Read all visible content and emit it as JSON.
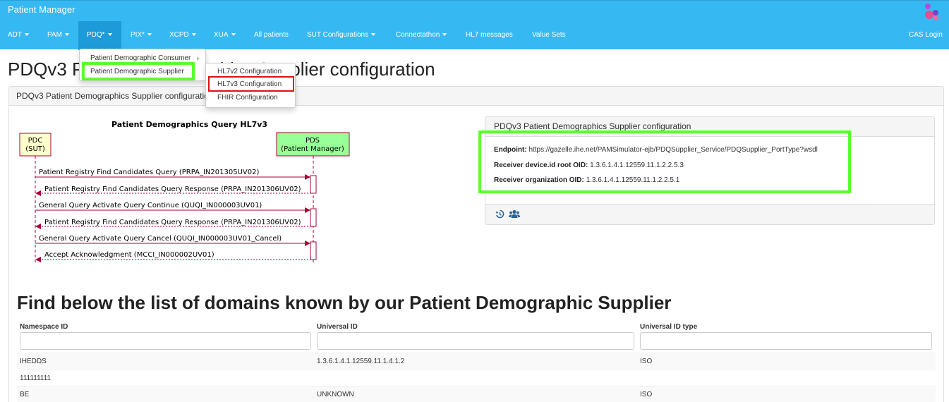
{
  "app": {
    "title": "Patient Manager"
  },
  "nav": {
    "items": [
      {
        "label": "ADT"
      },
      {
        "label": "PAM"
      },
      {
        "label": "PDQ*"
      },
      {
        "label": "PIX*"
      },
      {
        "label": "XCPD"
      },
      {
        "label": "XUA"
      },
      {
        "label": "All patients"
      },
      {
        "label": "SUT Configurations"
      },
      {
        "label": "Connectathon"
      },
      {
        "label": "HL7 messages"
      },
      {
        "label": "Value Sets"
      }
    ],
    "login": "CAS Login"
  },
  "page": {
    "title": "PDQv3 Patient Demographics Supplier configuration"
  },
  "panel": {
    "heading": "PDQv3 Patient Demographics Supplier configuration"
  },
  "dropdown": {
    "items": [
      {
        "label": "Patient Demographic Consumer"
      },
      {
        "label": "Patient Demographic Supplier"
      }
    ],
    "submenu": [
      {
        "label": "HL7v2 Configuration"
      },
      {
        "label": "HL7v3 Configuration"
      },
      {
        "label": "FHIR Configuration"
      }
    ]
  },
  "sequence": {
    "title": "Patient Demographics Query HL7v3",
    "actor_left": {
      "line1": "PDC",
      "line2": "(SUT)"
    },
    "actor_right": {
      "line1": "PDS",
      "line2": "(Patient Manager)"
    },
    "messages": [
      "Patient Registry Find Candidates Query (PRPA_IN201305UV02)",
      "Patient Registry Find Candidates Query Response (PRPA_IN201306UV02)",
      "General Query Activate Query Continue (QUQI_IN000003UV01)",
      "Patient Registry Find Candidates Query Response (PRPA_IN201306UV02)",
      "General Query Activate Query Cancel (QUQI_IN000003UV01_Cancel)",
      "Accept Acknowledgment (MCCI_IN000002UV01)"
    ]
  },
  "config": {
    "heading": "PDQv3 Patient Demographics Supplier configuration",
    "endpoint_label": "Endpoint:",
    "endpoint_value": "https://gazelle.ihe.net/PAMSimulator-ejb/PDQSupplier_Service/PDQSupplier_PortType?wsdl",
    "device_label": "Receiver device.id root OID:",
    "device_value": "1.3.6.1.4.1.12559.11.1.2.2.5.3",
    "org_label": "Receiver organization OID:",
    "org_value": "1.3.6.1.4.1.12559.11.1.2.2.5.1",
    "icons": [
      "history-icon",
      "users-icon"
    ]
  },
  "domains": {
    "title": "Find below the list of domains known by our Patient Demographic Supplier",
    "columns": [
      "Namespace ID",
      "Universal ID",
      "Universal ID type"
    ],
    "rows": [
      [
        "IHEDDS",
        "1.3.6.1.4.1.12559.11.1.4.1.2",
        "ISO"
      ],
      [
        "111111111",
        "",
        ""
      ],
      [
        "BE",
        "UNKNOWN",
        "ISO"
      ]
    ]
  },
  "colors": {
    "navbar": "#36b9f3",
    "nav_active": "#1d9bd8",
    "highlight_green": "#5cff2e",
    "highlight_red": "#e01010",
    "actor_left_fill": "#ffffcc",
    "actor_right_fill": "#99ff99",
    "arrow": "#a80036"
  }
}
